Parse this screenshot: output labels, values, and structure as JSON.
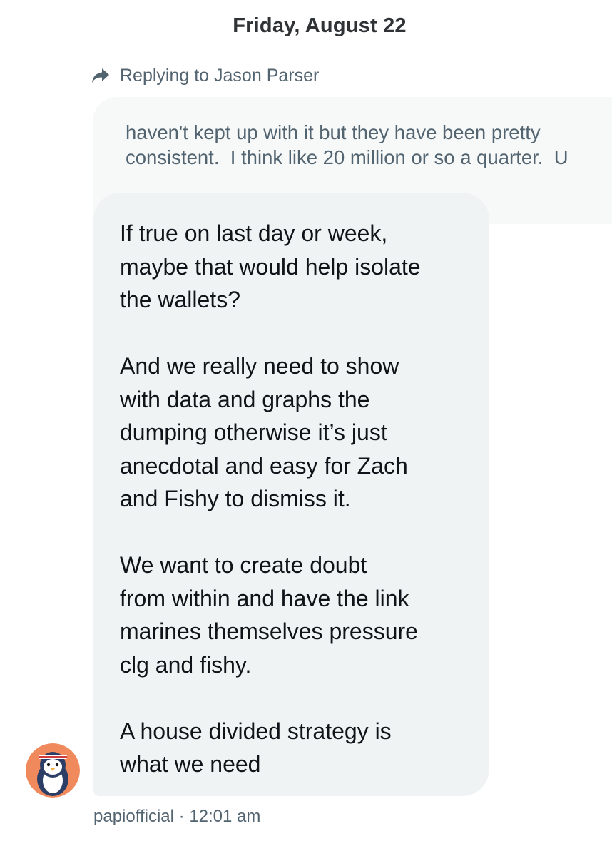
{
  "conversation": {
    "date_divider": "Friday, August 22",
    "reply": {
      "prefix": "Replying to",
      "target": "Jason Parser",
      "quoted_text": "haven't kept up with it but they have been pretty\nconsistent.  I think like 20 million or so a quarter.  U"
    },
    "message": {
      "text": "If true on last day or week,\nmaybe that would help isolate\nthe wallets?\n\nAnd we really need to show\nwith data and graphs the\ndumping otherwise it’s just\nanecdotal and easy for Zach\nand Fishy to dismiss it.\n\nWe want to create doubt\nfrom within and have the link\nmarines themselves pressure\nclg and fishy.\n\nA house divided strategy is\nwhat we need",
      "sender": "papiofficial",
      "separator": "·",
      "time": "12:01 am"
    }
  },
  "icons": {
    "reply": "reply-arrow-icon",
    "avatar": "penguin-avatar"
  },
  "colors": {
    "bubble": "#eff3f4",
    "quoted_bubble": "#f7f9f9",
    "secondary_text": "#536471",
    "avatar_background": "#f08a5d"
  }
}
